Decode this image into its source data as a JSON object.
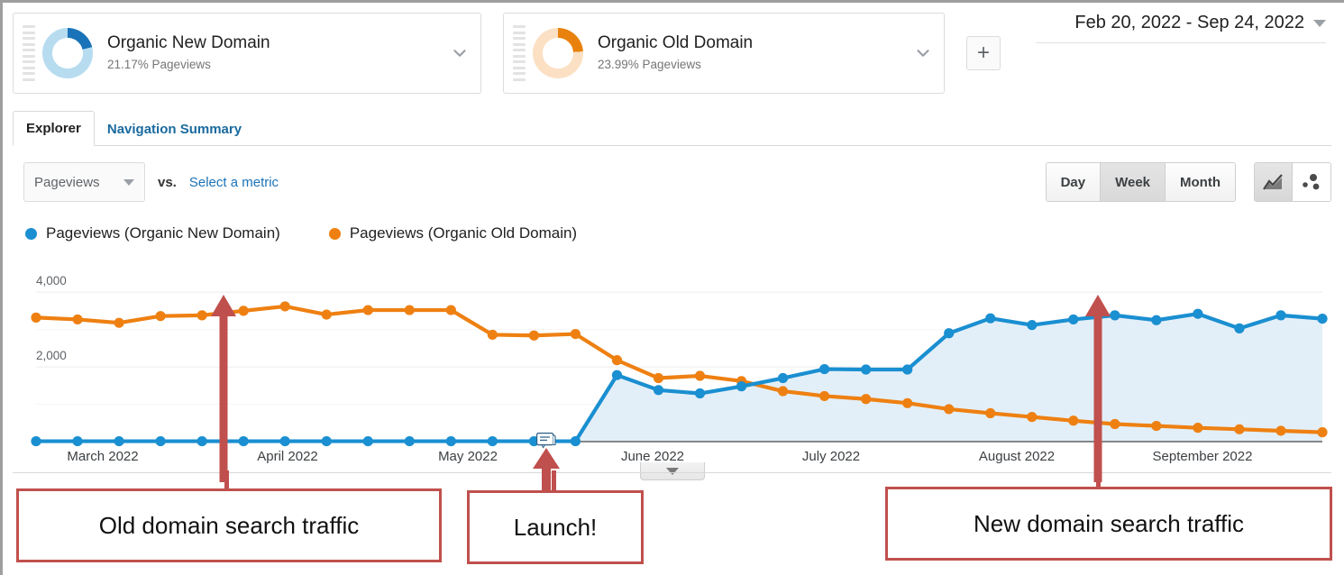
{
  "segments": [
    {
      "name": "segment-organic-new-domain",
      "title": "Organic New Domain",
      "metric": "21.17% Pageviews",
      "color": "#1a73b8",
      "pct": 21.17
    },
    {
      "name": "segment-organic-old-domain",
      "title": "Organic Old Domain",
      "metric": "23.99% Pageviews",
      "color": "#e8820c",
      "pct": 23.99
    }
  ],
  "add_segment_label": "+",
  "date_range": {
    "label": "Feb 20, 2022 - Sep 24, 2022"
  },
  "tabs": [
    {
      "label": "Explorer",
      "active": true
    },
    {
      "label": "Navigation Summary",
      "active": false
    }
  ],
  "toolbar": {
    "metric_select": "Pageviews",
    "vs_label": "vs.",
    "select_metric_link": "Select a metric",
    "granularity": [
      "Day",
      "Week",
      "Month"
    ],
    "granularity_selected": "Week",
    "chart_types": [
      "line-chart-icon",
      "motion-chart-icon"
    ],
    "chart_type_selected": "line-chart-icon"
  },
  "chart_data": {
    "type": "line",
    "title": "",
    "xlabel": "",
    "ylabel": "",
    "grid": true,
    "legend_position": "top-left",
    "ylim": [
      0,
      4800
    ],
    "yticks": [
      2000,
      4000
    ],
    "ytick_labels": [
      "2,000",
      "4,000"
    ],
    "xtick_labels": [
      "March 2022",
      "April 2022",
      "May 2022",
      "June 2022",
      "July 2022",
      "August 2022",
      "September 2022"
    ],
    "x": [
      "Feb 20",
      "Feb 27",
      "Mar 6",
      "Mar 13",
      "Mar 20",
      "Mar 27",
      "Apr 3",
      "Apr 10",
      "Apr 17",
      "Apr 24",
      "May 1",
      "May 8",
      "May 15",
      "May 22",
      "May 29",
      "Jun 5",
      "Jun 12",
      "Jun 19",
      "Jun 26",
      "Jul 3",
      "Jul 10",
      "Jul 17",
      "Jul 24",
      "Jul 31",
      "Aug 7",
      "Aug 14",
      "Aug 21",
      "Aug 28",
      "Sep 4",
      "Sep 11",
      "Sep 18"
    ],
    "series": [
      {
        "name": "Pageviews (Organic New Domain)",
        "color": "#1a8fd1",
        "fill": "#e3eff8",
        "values": [
          10,
          10,
          10,
          10,
          10,
          10,
          10,
          10,
          10,
          10,
          10,
          10,
          10,
          10,
          1780,
          1380,
          1290,
          1480,
          1700,
          1940,
          1930,
          1930,
          2900,
          3300,
          3120,
          3270,
          3380,
          3250,
          3420,
          3030,
          3380,
          3290
        ]
      },
      {
        "name": "Pageviews (Organic Old Domain)",
        "color": "#ee8012",
        "fill": "none",
        "values": [
          3320,
          3270,
          3180,
          3360,
          3380,
          3500,
          3620,
          3400,
          3520,
          3520,
          3520,
          2860,
          2840,
          2880,
          2180,
          1700,
          1760,
          1620,
          1350,
          1220,
          1140,
          1030,
          870,
          760,
          660,
          560,
          470,
          420,
          370,
          330,
          290,
          250
        ]
      }
    ]
  },
  "annotations": {
    "note_icon": "annotation-note-icon",
    "callouts": [
      {
        "label": "Old domain search traffic",
        "color": "#c0504d"
      },
      {
        "label": "Launch!",
        "color": "#c0504d"
      },
      {
        "label": "New domain search traffic",
        "color": "#c0504d"
      }
    ]
  }
}
